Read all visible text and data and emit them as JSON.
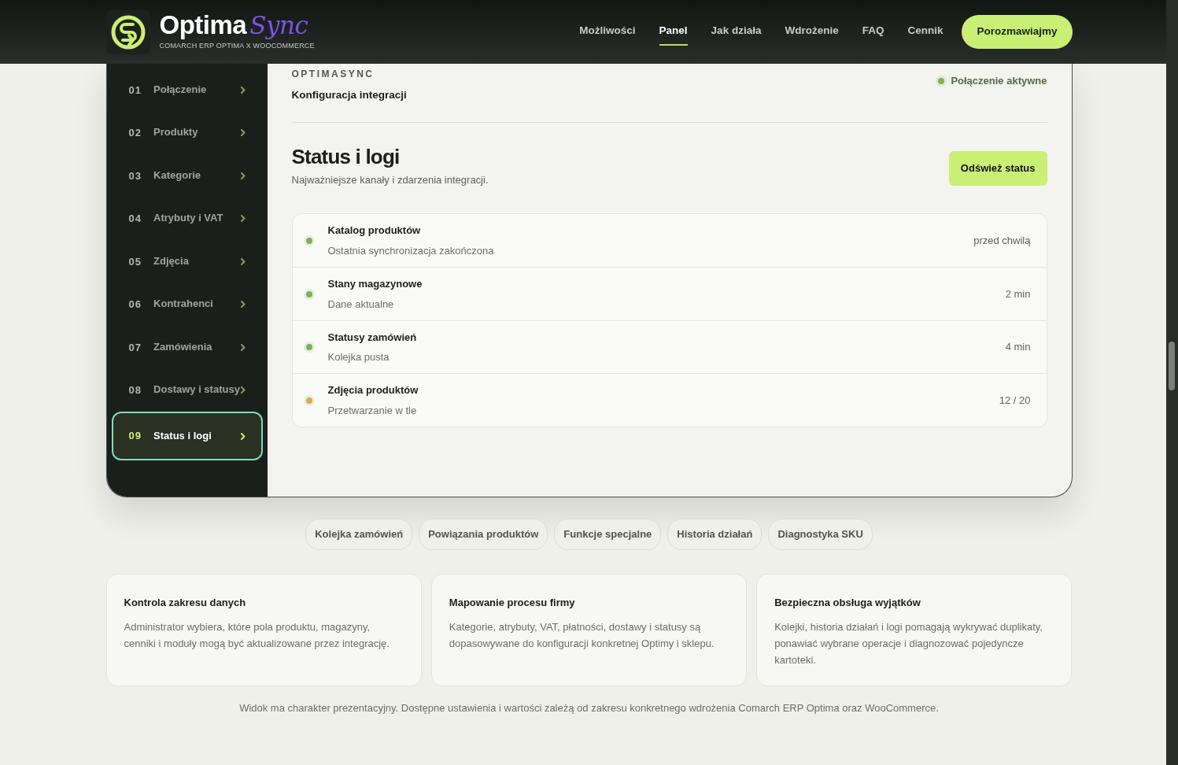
{
  "header": {
    "logo": {
      "title": "Optima",
      "title_accent": "Sync",
      "subtitle": "COMARCH ERP OPTIMA X WOOCOMMERCE"
    },
    "nav": [
      {
        "label": "Możliwości",
        "selected": false
      },
      {
        "label": "Panel",
        "selected": true
      },
      {
        "label": "Jak działa",
        "selected": false
      },
      {
        "label": "Wdrożenie",
        "selected": false
      },
      {
        "label": "FAQ",
        "selected": false
      },
      {
        "label": "Cennik",
        "selected": false
      }
    ],
    "cta": "Porozmawiajmy"
  },
  "sidebar": {
    "items": [
      {
        "number": "01",
        "label": "Połączenie",
        "selected": false
      },
      {
        "number": "02",
        "label": "Produkty",
        "selected": false
      },
      {
        "number": "03",
        "label": "Kategorie",
        "selected": false
      },
      {
        "number": "04",
        "label": "Atrybuty i VAT",
        "selected": false
      },
      {
        "number": "05",
        "label": "Zdjęcia",
        "selected": false
      },
      {
        "number": "06",
        "label": "Kontrahenci",
        "selected": false
      },
      {
        "number": "07",
        "label": "Zamówienia",
        "selected": false
      },
      {
        "number": "08",
        "label": "Dostawy i statusy",
        "selected": false
      },
      {
        "number": "09",
        "label": "Status i logi",
        "selected": true
      }
    ]
  },
  "panel": {
    "eyebrow": "OPTIMASYNC",
    "subtitle": "Konfiguracja integracji",
    "connection": {
      "label": "Połączenie aktywne",
      "color": "#7cb257"
    },
    "title": "Status i logi",
    "description": "Najważniejsze kanały i zdarzenia integracji.",
    "button": "Odśwież status",
    "statuses": [
      {
        "name": "Katalog produktów",
        "detail": "Ostatnia synchronizacja zakończona",
        "time": "przed chwilą",
        "color": "#7cb257"
      },
      {
        "name": "Stany magazynowe",
        "detail": "Dane aktualne",
        "time": "2 min",
        "color": "#7cb257"
      },
      {
        "name": "Statusy zamówień",
        "detail": "Kolejka pusta",
        "time": "4 min",
        "color": "#7cb257"
      },
      {
        "name": "Zdjęcia produktów",
        "detail": "Przetwarzanie w tle",
        "time": "12 / 20",
        "color": "#e0a84e"
      }
    ]
  },
  "chips": [
    "Kolejka zamówień",
    "Powiązania produktów",
    "Funkcje specjalne",
    "Historia działań",
    "Diagnostyka SKU"
  ],
  "features": [
    {
      "title": "Kontrola zakresu danych",
      "text": "Administrator wybiera, które pola produktu, magazyny, cenniki i moduły mogą być aktualizowane przez integrację."
    },
    {
      "title": "Mapowanie procesu firmy",
      "text": "Kategorie, atrybuty, VAT, płatności, dostawy i statusy są dopasowywane do konfiguracji konkretnej Optimy i sklepu."
    },
    {
      "title": "Bezpieczna obsługa wyjątków",
      "text": "Kolejki, historia działań i logi pomagają wykrywać duplikaty, ponawiać wybrane operacje i diagnozować pojedyncze kartoteki."
    }
  ],
  "footnote": "Widok ma charakter prezentacyjny. Dostępne ustawienia i wartości zależą od zakresu konkretnego wdrożenia Comarch ERP Optima oraz WooCommerce."
}
